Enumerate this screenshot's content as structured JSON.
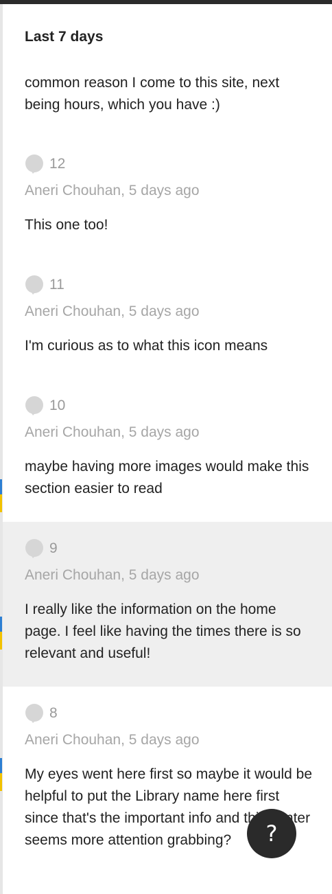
{
  "section": {
    "heading": "Last 7 days"
  },
  "partial_comment": {
    "text": "common reason I come to this site, next being hours, which you have :)"
  },
  "comments": [
    {
      "votes": "12",
      "meta": "Aneri Chouhan, 5 days ago",
      "text": "This one too!"
    },
    {
      "votes": "11",
      "meta": "Aneri Chouhan, 5 days ago",
      "text": "I'm curious as to what this icon means"
    },
    {
      "votes": "10",
      "meta": "Aneri Chouhan, 5 days ago",
      "text": "maybe having more images would make this section easier to read"
    },
    {
      "votes": "9",
      "meta": "Aneri Chouhan, 5 days ago",
      "text": "I really like the information on the home page. I feel like having the times there is so relevant and useful!",
      "highlighted": true
    },
    {
      "votes": "8",
      "meta": "Aneri Chouhan, 5 days ago",
      "text": "My eyes went here first so maybe it would be helpful to put the Library name here first since that's the important info and this center seems more attention grabbing?"
    }
  ],
  "help_button": {
    "label": "?"
  },
  "icons": {
    "vote": "comment-bubble-icon",
    "help": "question-mark-icon"
  },
  "colors": {
    "highlight_background": "#efefef",
    "meta_text": "#a6a6a6",
    "help_button": "#2a2a2a",
    "edge_accent_blue": "#2d7fd3",
    "edge_accent_yellow": "#f2c200"
  }
}
